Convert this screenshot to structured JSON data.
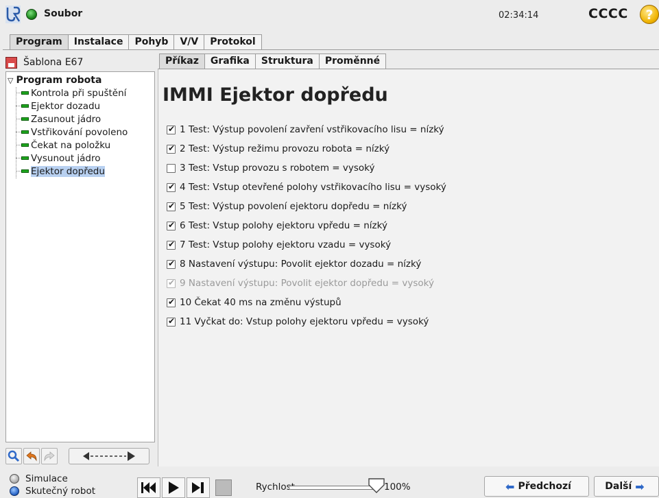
{
  "titlebar": {
    "file_label": "Soubor",
    "clock": "02:34:14",
    "robot_name": "CCCC",
    "help_symbol": "?"
  },
  "main_tabs": [
    "Program",
    "Instalace",
    "Pohyb",
    "V/V",
    "Protokol"
  ],
  "program": {
    "name": "Šablona E67"
  },
  "tree": {
    "root": "Program robota",
    "items": [
      "Kontrola při spuštění",
      "Ejektor dozadu",
      "Zasunout jádro",
      "Vstřikování povoleno",
      "Čekat na položku",
      "Vysunout jádro",
      "Ejektor dopředu"
    ],
    "selected_index": 6
  },
  "sub_tabs": [
    "Příkaz",
    "Grafika",
    "Struktura",
    "Proměnné"
  ],
  "content": {
    "title": "IMMI Ejektor dopředu",
    "checks": [
      {
        "label": "1 Test: Výstup povolení zavření vstřikovacího lisu = nízký",
        "checked": true,
        "enabled": true
      },
      {
        "label": "2 Test: Výstup režimu provozu robota = nízký",
        "checked": true,
        "enabled": true
      },
      {
        "label": "3 Test: Vstup provozu s robotem = vysoký",
        "checked": false,
        "enabled": true
      },
      {
        "label": "4 Test: Vstup otevřené polohy vstřikovacího lisu = vysoký",
        "checked": true,
        "enabled": true
      },
      {
        "label": "5 Test: Výstup povolení ejektoru dopředu = nízký",
        "checked": true,
        "enabled": true
      },
      {
        "label": "6 Test: Vstup polohy ejektoru vpředu = nízký",
        "checked": true,
        "enabled": true
      },
      {
        "label": "7 Test: Vstup polohy ejektoru vzadu = vysoký",
        "checked": true,
        "enabled": true
      },
      {
        "label": "8 Nastavení výstupu: Povolit ejektor dozadu = nízký",
        "checked": true,
        "enabled": true
      },
      {
        "label": "9 Nastavení výstupu: Povolit ejektor dopředu = vysoký",
        "checked": true,
        "enabled": false
      },
      {
        "label": "10 Čekat 40 ms na změnu výstupů",
        "checked": true,
        "enabled": true
      },
      {
        "label": "11 Vyčkat do: Vstup polohy ejektoru vpředu = vysoký",
        "checked": true,
        "enabled": true
      }
    ]
  },
  "bottom": {
    "simulation_label": "Simulace",
    "real_robot_label": "Skutečný robot",
    "speed_label": "Rychlost",
    "speed_value": "100%",
    "speed_fraction": 1.0,
    "prev_label": "Předchozí",
    "next_label": "Další"
  },
  "colors": {
    "accent_blue": "#2f69c8",
    "command_green": "#1ea51e",
    "selection": "#b8d0f0"
  }
}
